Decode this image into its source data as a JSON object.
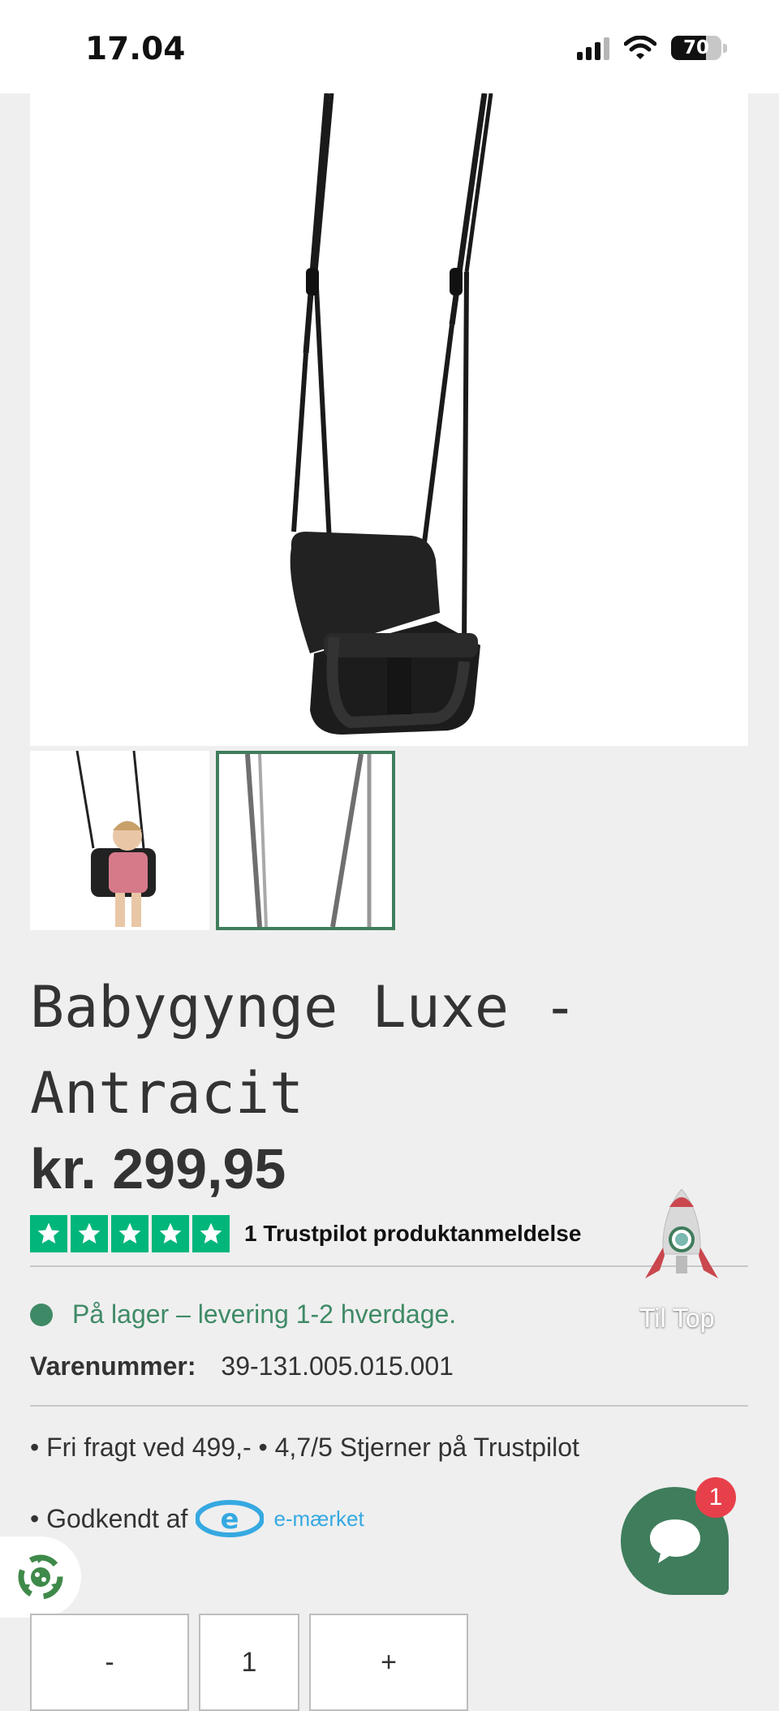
{
  "status_bar": {
    "time": "17.04",
    "battery": "70",
    "battery_level": 0.7
  },
  "gallery": {
    "thumbnail_count": 2,
    "active_thumbnail": 2
  },
  "product": {
    "title": "Babygynge Luxe - Antracit",
    "price": "kr. 299,95",
    "rating_stars": 5,
    "trustpilot_text": "1 Trustpilot produktanmeldelse",
    "stock_text": "På lager – levering 1-2 hverdage.",
    "sku_label": "Varenummer:",
    "sku_value": "39-131.005.015.001",
    "usps": "• Fri fragt ved 499,-  •  4,7/5 Stjerner på Trustpilot",
    "approved_prefix": "•  Godkendt af",
    "emark_label": "e-mærket"
  },
  "to_top": {
    "label": "Til Top"
  },
  "chat": {
    "badge_count": "1"
  },
  "quantity": {
    "minus": "-",
    "value": "1",
    "plus": "+"
  },
  "colors": {
    "accent": "#3f7d5c",
    "trustpilot": "#00b67a",
    "stock": "#3f8a66",
    "badge": "#e8404a"
  }
}
